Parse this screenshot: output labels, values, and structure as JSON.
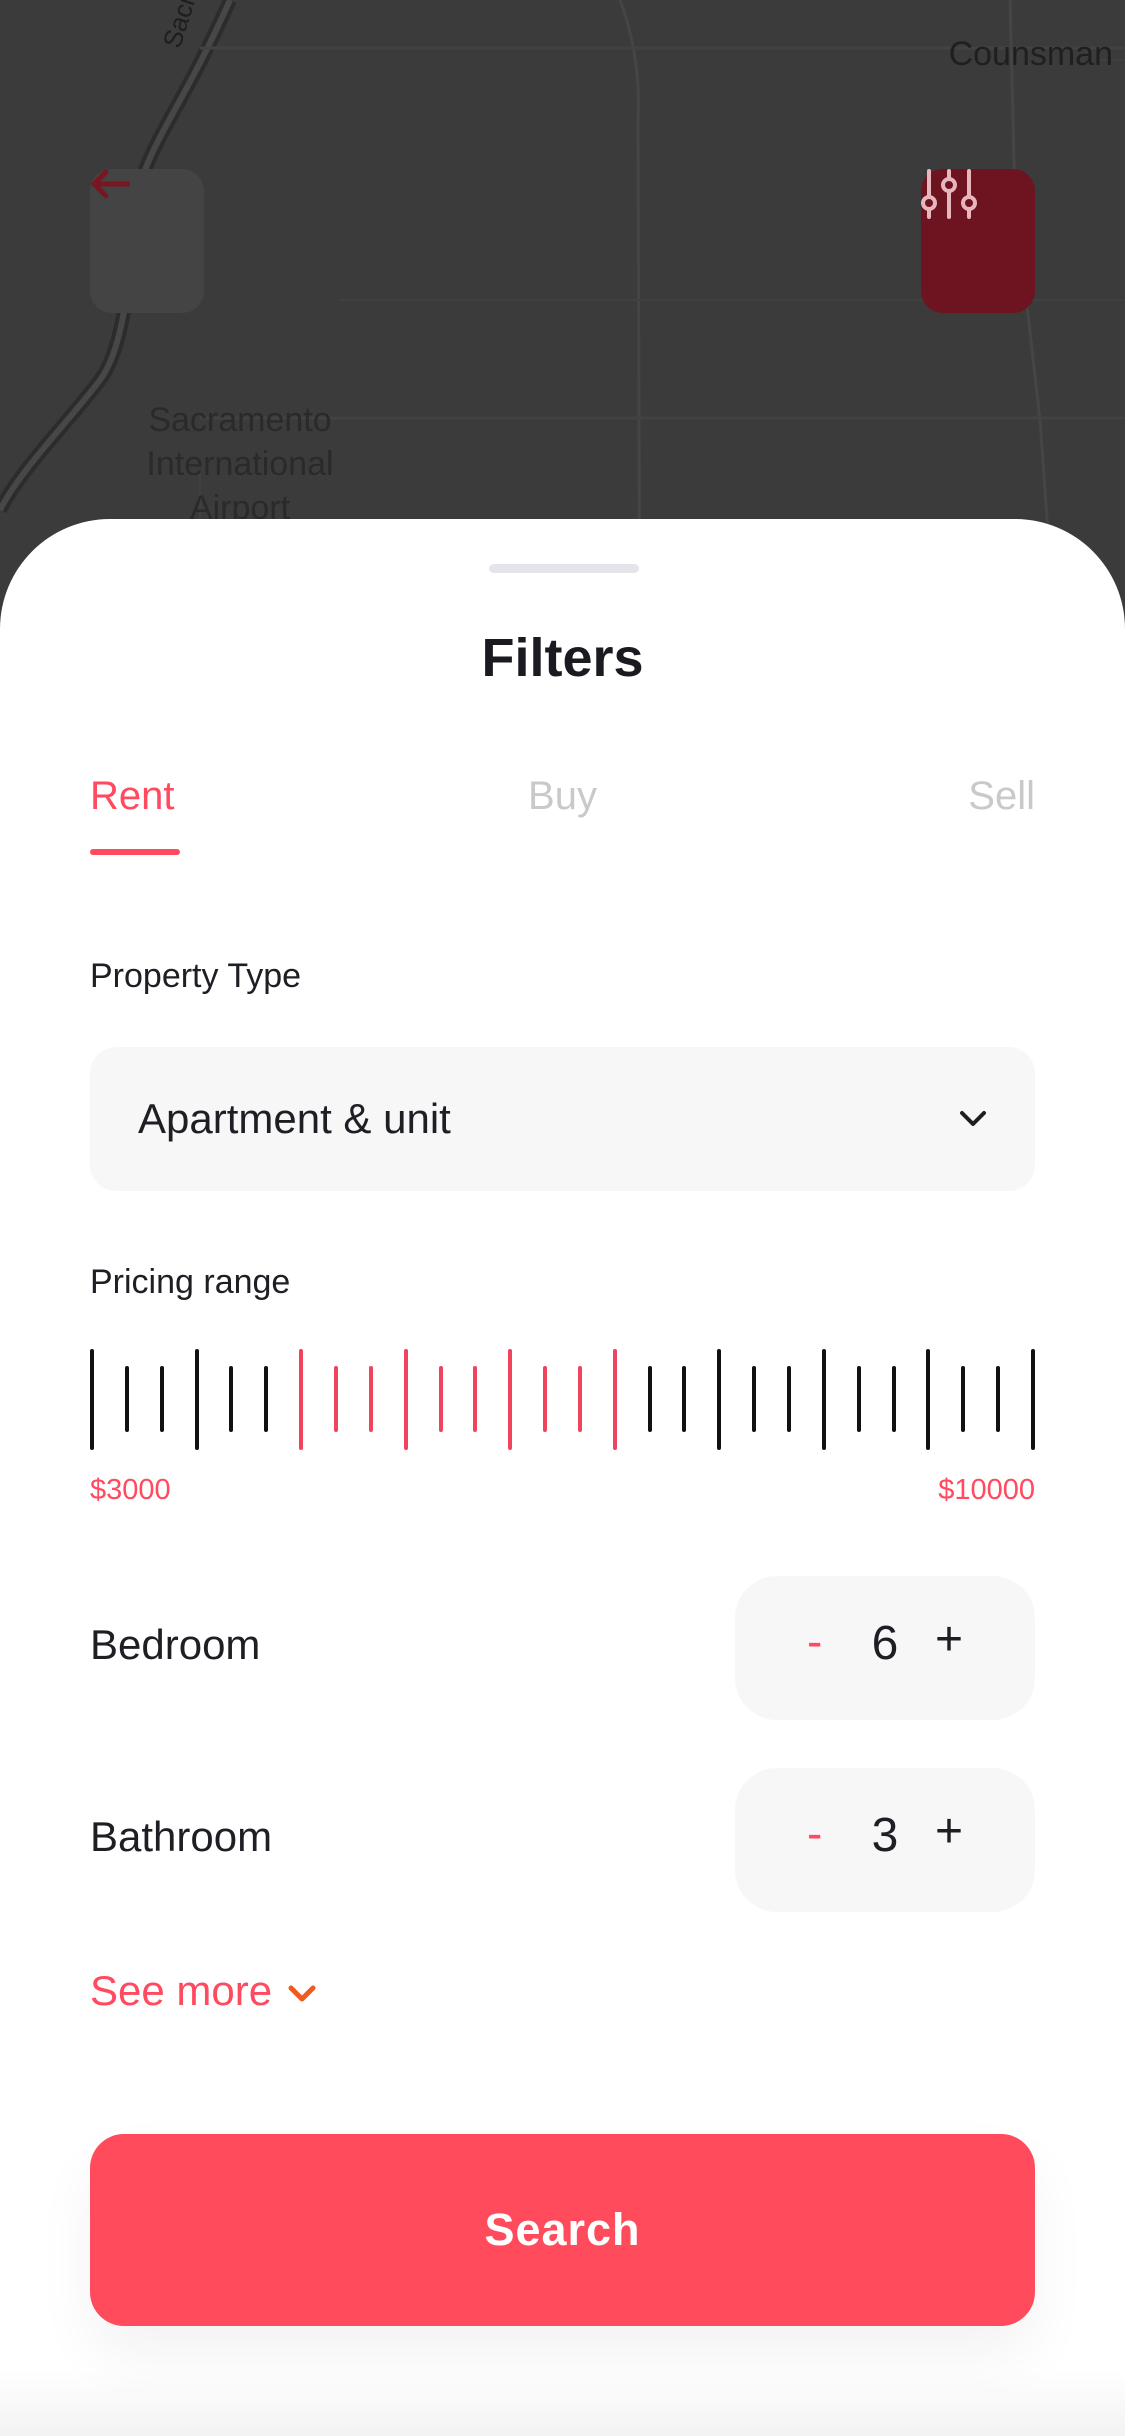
{
  "map": {
    "labels": {
      "top_right": "Counsman",
      "road": "Sacram",
      "airport_line1": "Sacramento",
      "airport_line2": "International",
      "airport_line3": "Airport"
    },
    "back_icon": "arrow-left-icon",
    "filter_icon": "sliders-icon"
  },
  "sheet": {
    "title": "Filters",
    "tabs": [
      {
        "label": "Rent",
        "active": true
      },
      {
        "label": "Buy",
        "active": false
      },
      {
        "label": "Sell",
        "active": false
      }
    ],
    "property_type": {
      "label": "Property Type",
      "value": "Apartment & unit",
      "icon": "chevron-down-icon"
    },
    "pricing": {
      "label": "Pricing range",
      "min_label": "$3000",
      "max_label": "$10000",
      "selected_fraction": [
        0.22,
        0.56
      ]
    },
    "bedroom": {
      "label": "Bedroom",
      "minus": "-",
      "value": "6",
      "plus": "+"
    },
    "bathroom": {
      "label": "Bathroom",
      "minus": "-",
      "value": "3",
      "plus": "+"
    },
    "see_more": {
      "label": "See more",
      "icon": "chevron-down-icon"
    },
    "search_button": {
      "label": "Search"
    }
  },
  "colors": {
    "accent": "#ff4a5f",
    "chevron_accent": "#f05a1e",
    "text": "#1e1e24",
    "muted": "#c9c9cc",
    "field_bg": "#f7f7f7"
  }
}
